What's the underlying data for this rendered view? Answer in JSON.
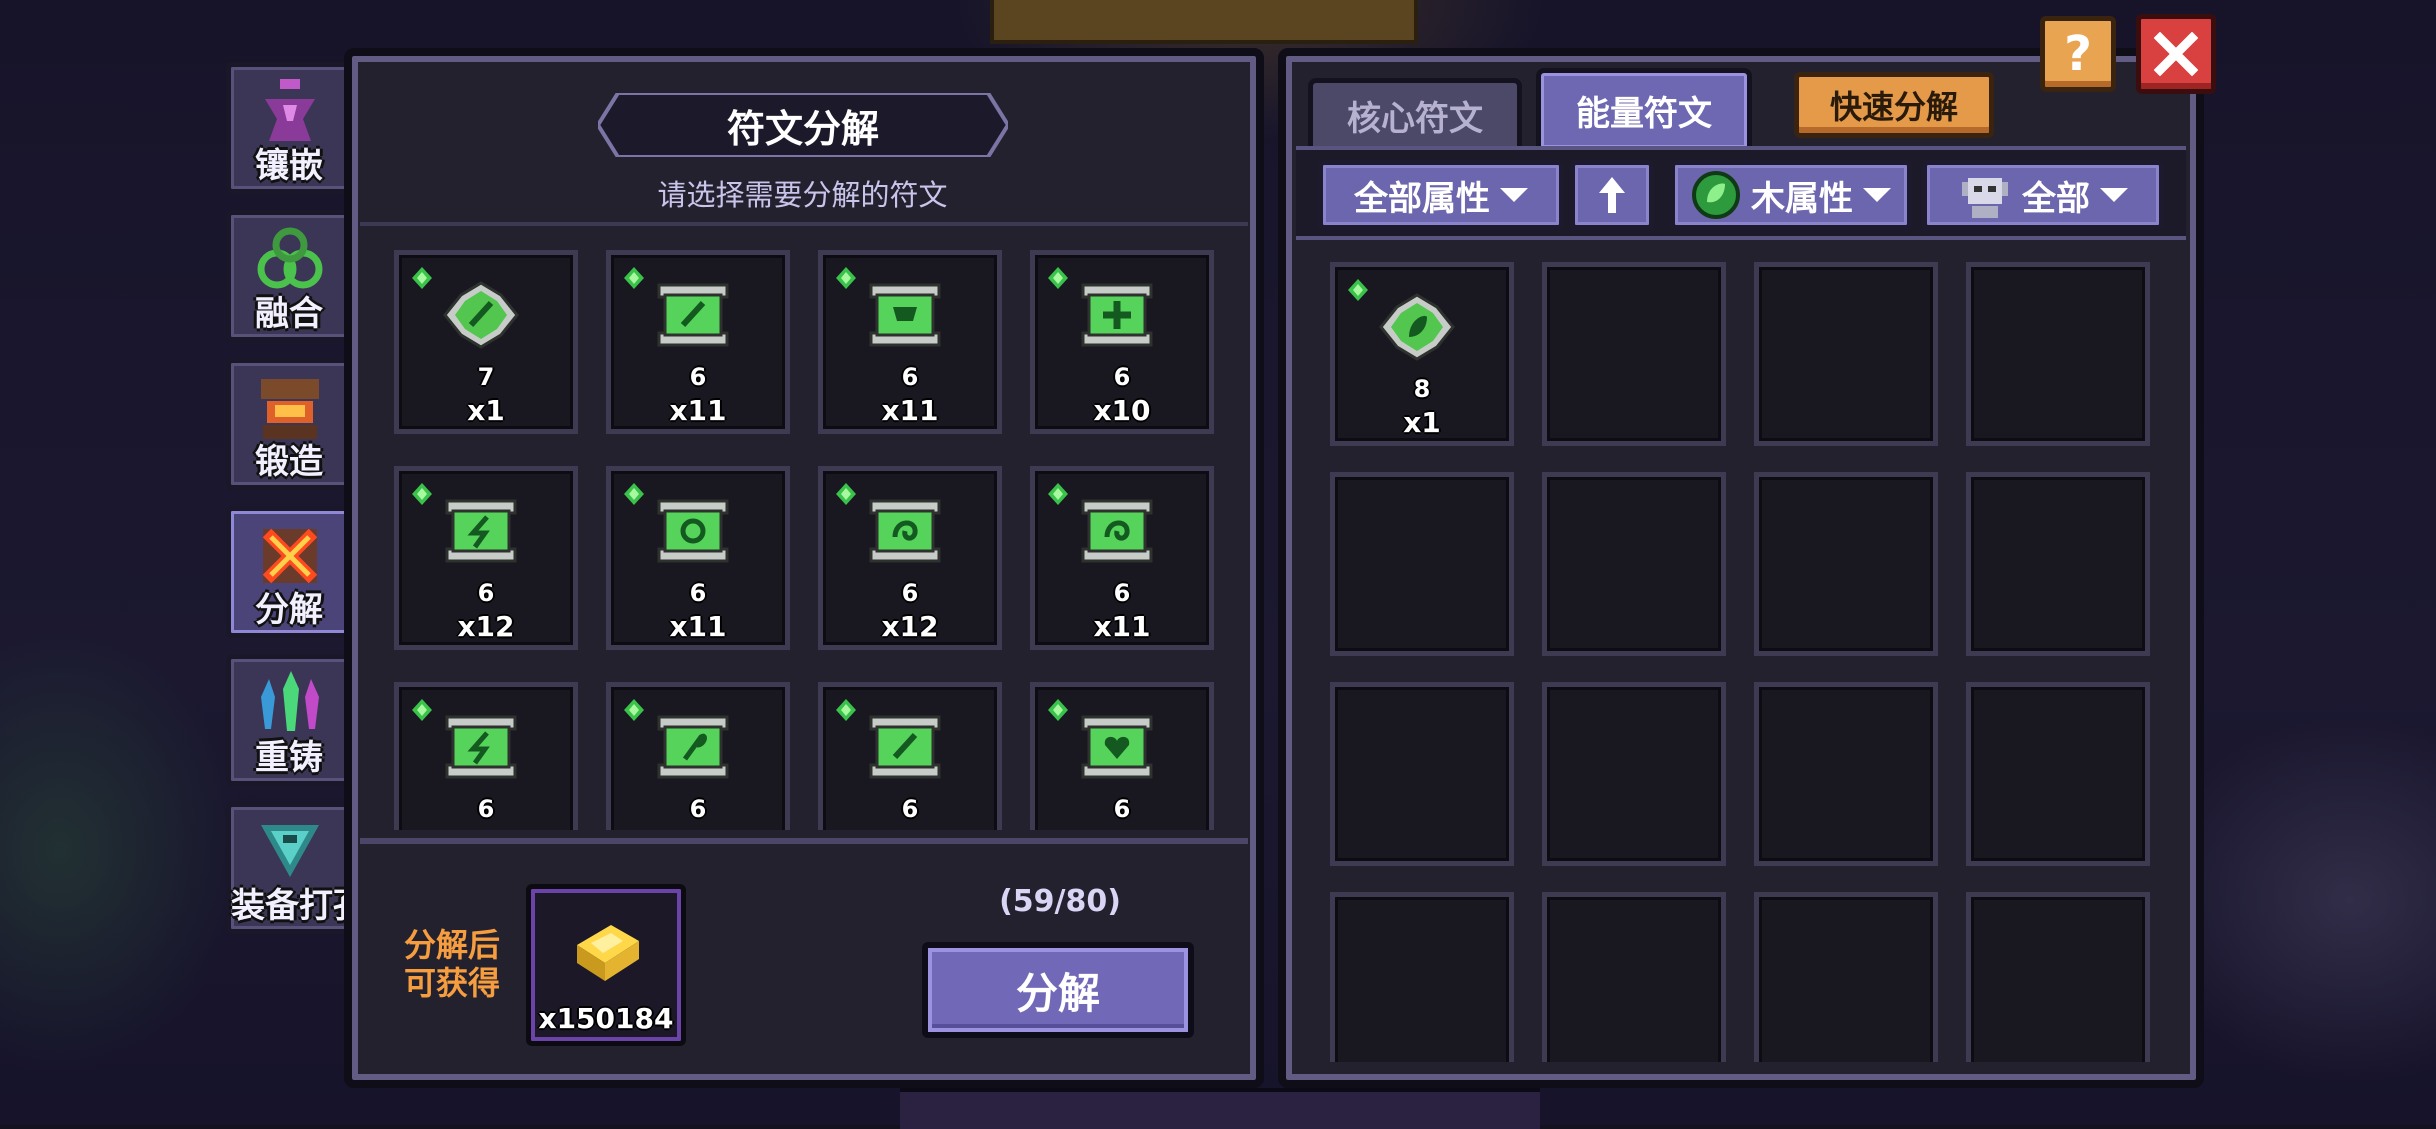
{
  "side_menu": [
    {
      "label": "镶嵌",
      "icon": "inlay-icon"
    },
    {
      "label": "融合",
      "icon": "fusion-icon"
    },
    {
      "label": "锻造",
      "icon": "forge-icon"
    },
    {
      "label": "分解",
      "icon": "decompose-icon",
      "active": true
    },
    {
      "label": "重铸",
      "icon": "recast-icon"
    },
    {
      "label": "装备打孔",
      "icon": "socket-punch-icon"
    }
  ],
  "left_panel": {
    "title": "符文分解",
    "subtitle": "请选择需要分解的符文",
    "runes": [
      {
        "level": "7",
        "qty": "x1",
        "symbol": "slash"
      },
      {
        "level": "6",
        "qty": "x11",
        "symbol": "slash"
      },
      {
        "level": "6",
        "qty": "x11",
        "symbol": "cup"
      },
      {
        "level": "6",
        "qty": "x10",
        "symbol": "cross"
      },
      {
        "level": "6",
        "qty": "x12",
        "symbol": "bolt"
      },
      {
        "level": "6",
        "qty": "x11",
        "symbol": "ring"
      },
      {
        "level": "6",
        "qty": "x12",
        "symbol": "swirl"
      },
      {
        "level": "6",
        "qty": "x11",
        "symbol": "swirl"
      },
      {
        "level": "6",
        "qty": "",
        "symbol": "bolt"
      },
      {
        "level": "6",
        "qty": "",
        "symbol": "hook"
      },
      {
        "level": "6",
        "qty": "",
        "symbol": "slash"
      },
      {
        "level": "6",
        "qty": "",
        "symbol": "heart"
      }
    ],
    "reward_label_1": "分解后",
    "reward_label_2": "可获得",
    "reward_qty": "x150184",
    "count": "(59/80)",
    "decompose_button": "分解"
  },
  "right_panel": {
    "tabs": [
      {
        "label": "核心符文",
        "active": false
      },
      {
        "label": "能量符文",
        "active": true
      }
    ],
    "quick_decompose": "快速分解",
    "filters": {
      "attribute": "全部属性",
      "element": "木属性",
      "type": "全部"
    },
    "inventory": [
      {
        "level": "8",
        "qty": "x1",
        "symbol": "leaf"
      }
    ]
  },
  "help_label": "?",
  "colors": {
    "rune_green": "#55d35a",
    "accent_purple": "#6e68b2",
    "orange": "#e49a48",
    "close_red": "#d94040"
  }
}
